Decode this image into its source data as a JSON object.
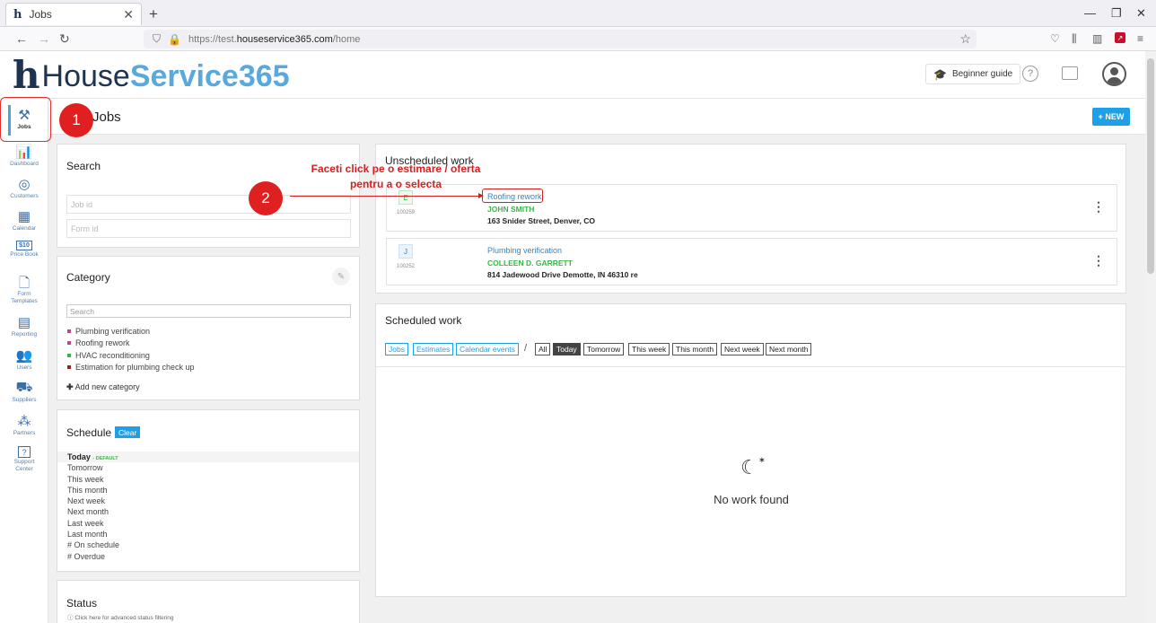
{
  "browser": {
    "tab_title": "Jobs",
    "tab_favicon": "h",
    "url_prefix": "https://test.",
    "url_domain": "houseservice365.com",
    "url_path": "/home"
  },
  "header": {
    "logo_mark": "h",
    "logo_text_1": "House",
    "logo_text_2": "Service365",
    "guide_label": "Beginner guide",
    "help_label": "?"
  },
  "sidebar": {
    "items": [
      {
        "label": "Jobs",
        "icon": "tools-icon"
      },
      {
        "label": "Dashboard",
        "icon": "chart-icon"
      },
      {
        "label": "Customers",
        "icon": "customers-icon"
      },
      {
        "label": "Calendar",
        "icon": "calendar-icon"
      },
      {
        "label": "Price Book",
        "icon": "pricebook-icon",
        "glyph": "$10"
      },
      {
        "label": "Form Templates",
        "icon": "form-icon"
      },
      {
        "label": "Reporting",
        "icon": "reporting-icon"
      },
      {
        "label": "Users",
        "icon": "users-icon"
      },
      {
        "label": "Suppliers",
        "icon": "truck-icon"
      },
      {
        "label": "Partners",
        "icon": "partners-icon"
      },
      {
        "label": "Support Center",
        "icon": "support-icon",
        "glyph": "?"
      }
    ]
  },
  "page": {
    "title": "Jobs",
    "new_button": "+ NEW"
  },
  "search_panel": {
    "title": "Search",
    "job_id_placeholder": "Job id",
    "form_id_placeholder": "Form id"
  },
  "category_panel": {
    "title": "Category",
    "search_placeholder": "Search",
    "items": [
      {
        "label": "Plumbing verification",
        "color": "#c0458c"
      },
      {
        "label": "Roofing rework",
        "color": "#c0458c"
      },
      {
        "label": "HVAC reconditioning",
        "color": "#3bb54a"
      },
      {
        "label": "Estimation for plumbing check up",
        "color": "#9b1f1f"
      }
    ],
    "add_label": "Add new category"
  },
  "schedule_panel": {
    "title": "Schedule",
    "clear_label": "Clear",
    "today_label": "Today",
    "default_tag": "- DEFAULT",
    "items": [
      "Tomorrow",
      "This week",
      "This month",
      "Next week",
      "Next month",
      "Last week",
      "Last month",
      "# On schedule",
      "# Overdue"
    ]
  },
  "status_panel": {
    "title": "Status",
    "hint": "Click here for advanced status filtering"
  },
  "unscheduled": {
    "title": "Unscheduled work",
    "jobs": [
      {
        "badge": "E",
        "id": "100259",
        "title": "Roofing rework",
        "customer": "JOHN SMITH",
        "address": "163 Snider Street, Denver, CO"
      },
      {
        "badge": "J",
        "id": "100252",
        "title": "Plumbing verification",
        "customer": "COLLEEN D. GARRETT",
        "address": "814 Jadewood Drive Demotte, IN 46310 re"
      }
    ]
  },
  "scheduled": {
    "title": "Scheduled work",
    "type_filters": [
      "Jobs",
      "Estimates",
      "Calendar events"
    ],
    "slash": "/",
    "time_filters": [
      "All",
      "Today",
      "Tomorrow",
      "This week",
      "This month",
      "Next week",
      "Next month"
    ],
    "active_filter": "Today",
    "empty_text": "No work found"
  },
  "annotations": {
    "step1": "1",
    "step2": "2",
    "instruction_line1": "Faceti click pe o estimare / oferta",
    "instruction_line2": "pentru a o selecta"
  },
  "colors": {
    "brand_dark": "#1e3350",
    "brand_light": "#5aa9dc",
    "accent_blue": "#1ea0e8",
    "green": "#3bb54a",
    "annotation_red": "#d81f1f"
  }
}
